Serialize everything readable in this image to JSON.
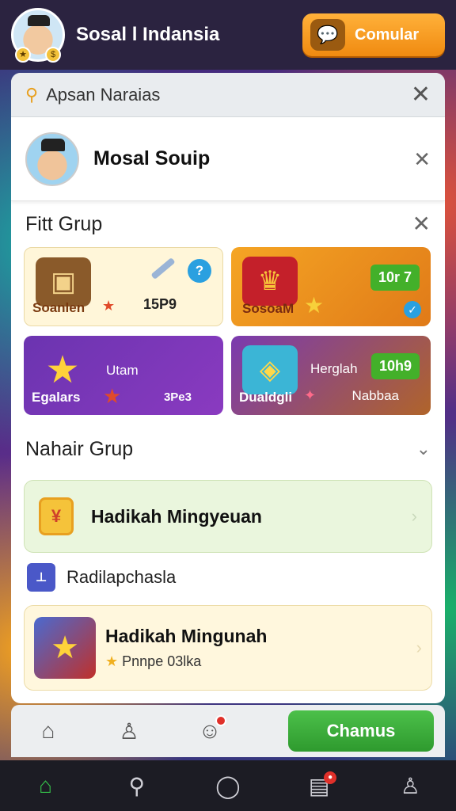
{
  "header": {
    "title": "Sosal l Indansia",
    "connect_label": "Comular",
    "connect_icon": "chat-bubble-icon"
  },
  "search": {
    "text": "Apsan Naraias"
  },
  "profile": {
    "name": "Mosal Souip"
  },
  "section1": {
    "title": "Fitt Grup",
    "cards": [
      {
        "name": "Soanlen",
        "value": "15P9"
      },
      {
        "name": "SosoaM",
        "tag": "10r 7"
      },
      {
        "name": "Egalars",
        "badge": "Utam",
        "value": "3Pe3"
      },
      {
        "name": "Dualdgli",
        "subtitle": "Herglah",
        "tag": "10h9",
        "value": "Nabbaa"
      }
    ]
  },
  "section2": {
    "title": "Nahair Grup",
    "weekly_title": "Hadikah Mingyeuan",
    "sub_label": "Radilapchasla",
    "reward_title": "Hadikah Mingunah",
    "reward_sub": "Pnnpe 03lka"
  },
  "actions": {
    "cta_label": "Chamus"
  }
}
